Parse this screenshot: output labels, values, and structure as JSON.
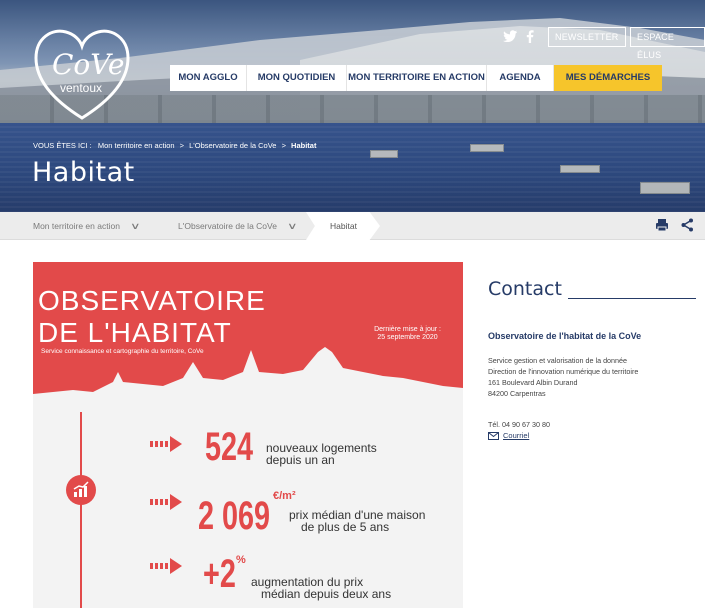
{
  "header": {
    "logo_text": "CoVe",
    "logo_sub": "ventoux",
    "social": [
      "twitter-icon",
      "facebook-icon"
    ],
    "newsletter_label": "NEWSLETTER",
    "espace_label": "ESPACE ÉLUS",
    "nav": [
      {
        "label": "MON AGGLO"
      },
      {
        "label": "MON QUOTIDIEN"
      },
      {
        "label": "MON TERRITOIRE EN ACTION"
      },
      {
        "label": "AGENDA"
      },
      {
        "label": "MES DÉMARCHES"
      }
    ],
    "nav_active_color": "#f6c52b",
    "breadcrumb": {
      "prefix": "VOUS ÊTES ICI :",
      "items": [
        "Mon territoire en action",
        "L'Observatoire de la CoVe",
        "Habitat"
      ],
      "sep": ">"
    },
    "title": "Habitat"
  },
  "subbar": {
    "items": [
      "Mon territoire en action",
      "L'Observatoire de la CoVe"
    ],
    "current": "Habitat"
  },
  "infographic": {
    "title_line1": "OBSERVATOIRE",
    "title_line2": "DE L'HABITAT",
    "subtitle": "Service connaissance et cartographie du territoire, CoVe",
    "update_line1": "Dernière mise à jour :",
    "update_line2": "25 septembre 2020",
    "accent": "#e24a4a",
    "stats": [
      {
        "value": "524",
        "unit": "",
        "desc1": "nouveaux logements",
        "desc2": "depuis un an"
      },
      {
        "value": "2 069",
        "unit": "€/m²",
        "desc1": "prix médian d'une maison",
        "desc2": "de plus de 5 ans"
      },
      {
        "value": "+2",
        "unit": "%",
        "desc1": "augmentation du prix",
        "desc2": "médian depuis deux ans"
      }
    ]
  },
  "contact": {
    "heading": "Contact",
    "name": "Observatoire de l'habitat de la CoVe",
    "lines": [
      "Service gestion et valorisation de la donnée",
      "Direction de l'innovation numérique du territoire",
      "161 Boulevard Albin Durand",
      "84200 Carpentras"
    ],
    "phone": "Tél. 04 90 67 30 80",
    "email_label": "Courriel"
  }
}
